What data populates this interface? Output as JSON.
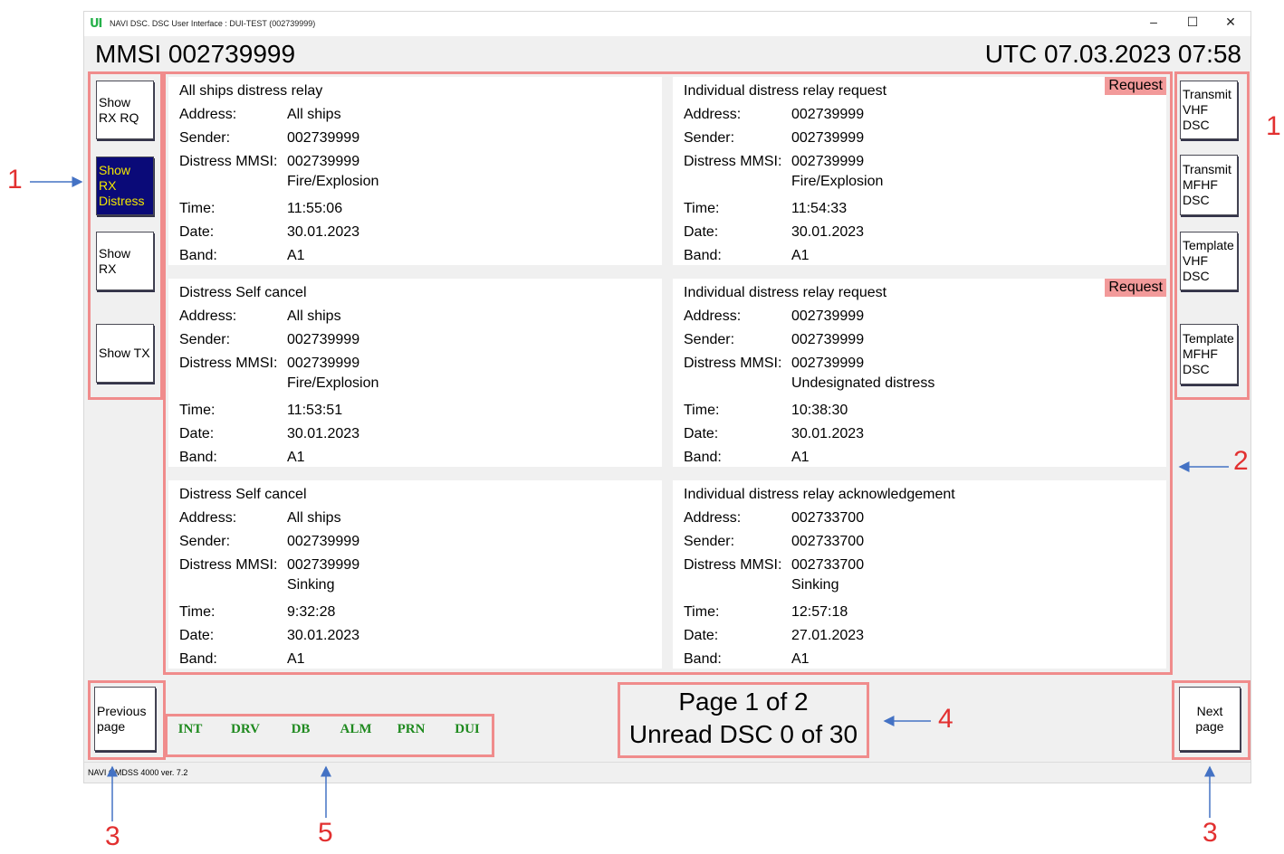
{
  "window": {
    "logo": "UI",
    "title": "NAVI DSC. DSC User Interface : DUI-TEST (002739999)",
    "minimize": "–",
    "maximize": "☐",
    "close": "✕"
  },
  "header": {
    "mmsi": "MMSI 002739999",
    "utc": "UTC 07.03.2023 07:58"
  },
  "left_buttons": [
    {
      "label": "Show RX RQ",
      "active": false
    },
    {
      "label": "Show RX Distress",
      "active": true
    },
    {
      "label": "Show RX",
      "active": false
    },
    {
      "label": "Show TX",
      "active": false
    }
  ],
  "right_buttons": [
    {
      "label": "Transmit VHF DSC"
    },
    {
      "label": "Transmit MFHF DSC"
    },
    {
      "label": "Template VHF DSC"
    },
    {
      "label": "Template MFHF DSC"
    }
  ],
  "field_labels": {
    "address": "Address:",
    "sender": "Sender:",
    "distress_mmsi": "Distress MMSI:",
    "time": "Time:",
    "date": "Date:",
    "band": "Band:"
  },
  "cards": [
    {
      "title": "All ships distress relay",
      "tag": "",
      "address": "All ships",
      "sender": "002739999",
      "distress_mmsi": "002739999",
      "nature": "Fire/Explosion",
      "time": "11:55:06",
      "date": "30.01.2023",
      "band": "A1"
    },
    {
      "title": "Individual distress relay request",
      "tag": "Request",
      "address": "002739999",
      "sender": "002739999",
      "distress_mmsi": "002739999",
      "nature": "Fire/Explosion",
      "time": "11:54:33",
      "date": "30.01.2023",
      "band": "A1"
    },
    {
      "title": "Distress Self cancel",
      "tag": "",
      "address": "All ships",
      "sender": "002739999",
      "distress_mmsi": "002739999",
      "nature": "Fire/Explosion",
      "time": "11:53:51",
      "date": "30.01.2023",
      "band": "A1"
    },
    {
      "title": "Individual distress relay request",
      "tag": "Request",
      "address": "002739999",
      "sender": "002739999",
      "distress_mmsi": "002739999",
      "nature": "Undesignated distress",
      "time": "10:38:30",
      "date": "30.01.2023",
      "band": "A1"
    },
    {
      "title": "Distress Self cancel",
      "tag": "",
      "address": "All ships",
      "sender": "002739999",
      "distress_mmsi": "002739999",
      "nature": "Sinking",
      "time": "9:32:28",
      "date": "30.01.2023",
      "band": "A1"
    },
    {
      "title": "Individual distress relay acknowledgement",
      "tag": "",
      "address": "002733700",
      "sender": "002733700",
      "distress_mmsi": "002733700",
      "nature": "Sinking",
      "time": "12:57:18",
      "date": "27.01.2023",
      "band": "A1"
    }
  ],
  "footer": {
    "previous_page": "Previous page",
    "next_page": "Next page",
    "page": "Page 1 of 2",
    "unread": "Unread DSC 0 of 30",
    "status_tags": [
      "INT",
      "DRV",
      "DB",
      "ALM",
      "PRN",
      "DUI"
    ],
    "status_color": "#1f8a1f"
  },
  "statusbar": {
    "version": "NAVI GMDSS 4000 ver. 7.2"
  },
  "annotations": {
    "left_buttons": "1",
    "right_buttons": "1",
    "message_area": "2",
    "previous_page": "3",
    "next_page": "3",
    "page_info": "4",
    "status_tags": "5",
    "color": "#e23030",
    "arrow_color": "#4472c4"
  }
}
